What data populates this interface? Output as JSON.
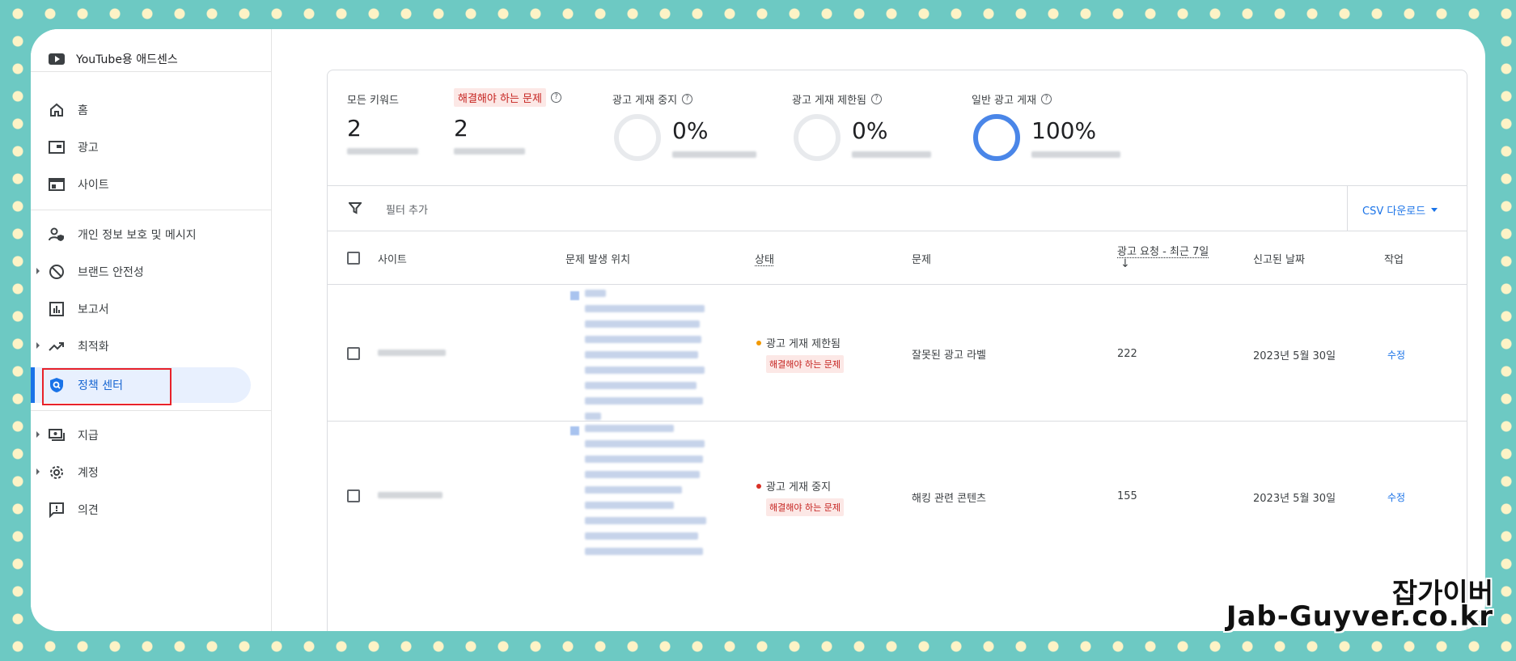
{
  "sidebar": {
    "brand": "YouTube용 애드센스",
    "items": [
      {
        "label": "홈",
        "icon": "home-icon"
      },
      {
        "label": "광고",
        "icon": "ads-icon"
      },
      {
        "label": "사이트",
        "icon": "sites-icon"
      },
      {
        "label": "개인 정보 보호 및 메시지",
        "icon": "privacy-icon"
      },
      {
        "label": "브랜드 안전성",
        "icon": "block-icon"
      },
      {
        "label": "보고서",
        "icon": "reports-icon"
      },
      {
        "label": "최적화",
        "icon": "trending-icon"
      },
      {
        "label": "정책 센터",
        "icon": "policy-shield-icon"
      },
      {
        "label": "지급",
        "icon": "payments-icon"
      },
      {
        "label": "계정",
        "icon": "gear-icon"
      },
      {
        "label": "의견",
        "icon": "feedback-icon"
      }
    ]
  },
  "summary": {
    "all_keywords": {
      "label": "모든 키워드",
      "value": "2"
    },
    "issues_to_fix": {
      "label": "해결해야 하는 문제",
      "value": "2"
    },
    "ads_stopped": {
      "label": "광고 게재 중지",
      "percent": "0%",
      "fraction": 0
    },
    "ads_limited": {
      "label": "광고 게재 제한됨",
      "percent": "0%",
      "fraction": 0
    },
    "ads_normal": {
      "label": "일반 광고 게재",
      "percent": "100%",
      "fraction": 1.0
    }
  },
  "filter": {
    "label": "필터 추가",
    "csv_label": "CSV 다운로드"
  },
  "table": {
    "headers": {
      "site": "사이트",
      "location": "문제 발생 위치",
      "status": "상태",
      "issue": "문제",
      "ad_requests": "광고 요청 - 최근 7일",
      "sort_arrow": "↓",
      "reported_date": "신고된 날짜",
      "action": "작업"
    },
    "rows": [
      {
        "status": "광고 게재 제한됨",
        "status_color": "#f29900",
        "chip": "해결해야 하는 문제",
        "issue": "잘못된 광고 라벨",
        "requests": "222",
        "date": "2023년 5월 30일",
        "action": "수정"
      },
      {
        "status": "광고 게재 중지",
        "status_color": "#d93025",
        "chip": "해결해야 하는 문제",
        "issue": "해킹 관련 콘텐츠",
        "requests": "155",
        "date": "2023년 5월 30일",
        "action": "수정"
      }
    ]
  },
  "watermark": {
    "line1": "잡가이버",
    "line2": "Jab-Guyver.co.kr"
  },
  "colors": {
    "accent": "#1a73e8",
    "warning": "#f29900",
    "error": "#d93025",
    "highlight_box": "#e8222a"
  }
}
